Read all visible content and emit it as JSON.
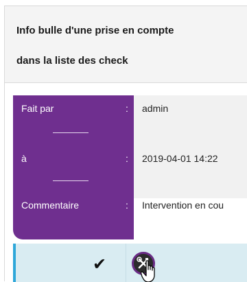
{
  "title": {
    "line1": "Info bulle d'une prise en compte",
    "line2": "dans la liste des check"
  },
  "tooltip": {
    "rows": [
      {
        "label": "Fait par",
        "colon": ":",
        "value": "admin"
      },
      {
        "label": "à",
        "colon": ":",
        "value": "2019-04-01 14:22"
      },
      {
        "label": "Commentaire",
        "colon": ":",
        "value": "Intervention en cou"
      }
    ]
  },
  "row": {
    "check_glyph": "✔",
    "intervention_icon": "wrench-screwdriver-icon"
  },
  "colors": {
    "tooltip_bg": "#6f2f8f",
    "row_bg": "#d9ecf2",
    "accent": "#2ea7d9"
  }
}
